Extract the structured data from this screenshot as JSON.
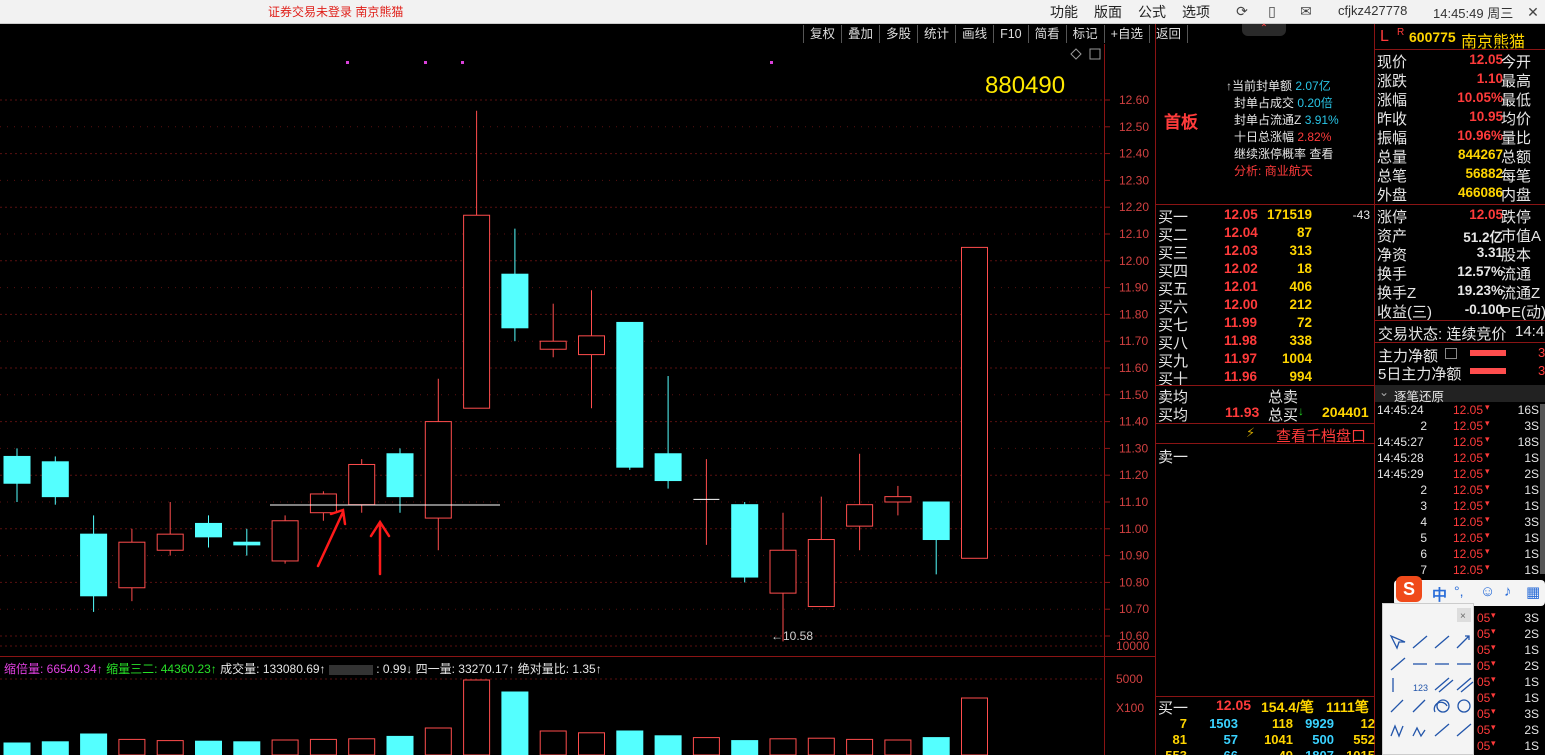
{
  "topbar": {
    "status": "证券交易未登录  南京熊猫",
    "menu": [
      "功能",
      "版面",
      "公式",
      "选项"
    ],
    "user": "cfjkz427778",
    "clock": "14:45:49 周三"
  },
  "chart_toolbar": [
    "复权",
    "叠加",
    "多股",
    "统计",
    "画线",
    "F10",
    "简看",
    "标记",
    "+自选",
    "返回"
  ],
  "chart": {
    "code_overlay": "880490",
    "low_label": "←10.58",
    "price_ticks": [
      "12.60",
      "12.50",
      "12.40",
      "12.30",
      "12.20",
      "12.10",
      "12.00",
      "11.90",
      "11.80",
      "11.70",
      "11.60",
      "11.50",
      "11.40",
      "11.30",
      "11.20",
      "11.10",
      "11.00",
      "10.90",
      "10.80",
      "10.70",
      "10.60"
    ],
    "volume_ticks": [
      "10000",
      "5000",
      "X100"
    ],
    "indicator_line": {
      "part1": "缩倍量: 66540.34↑",
      "part2": "缩量三二: 44360.23↑",
      "part3": "成交量: 133080.69↑",
      "part4": ": 0.99↓",
      "part5": "四一量: 33270.17↑",
      "part6": "绝对量比: 1.35↑"
    },
    "candles": [
      {
        "o": 11.27,
        "c": 11.17,
        "h": 11.3,
        "l": 11.1
      },
      {
        "o": 11.25,
        "c": 11.12,
        "h": 11.27,
        "l": 11.09
      },
      {
        "o": 10.98,
        "c": 10.75,
        "h": 11.05,
        "l": 10.69
      },
      {
        "o": 10.78,
        "c": 10.95,
        "h": 11.0,
        "l": 10.73
      },
      {
        "o": 10.92,
        "c": 10.98,
        "h": 11.1,
        "l": 10.9
      },
      {
        "o": 11.02,
        "c": 10.97,
        "h": 11.05,
        "l": 10.93
      },
      {
        "o": 10.95,
        "c": 10.94,
        "h": 11.0,
        "l": 10.9
      },
      {
        "o": 10.88,
        "c": 11.03,
        "h": 11.05,
        "l": 10.87
      },
      {
        "o": 11.06,
        "c": 11.13,
        "h": 11.14,
        "l": 11.03
      },
      {
        "o": 11.09,
        "c": 11.24,
        "h": 11.26,
        "l": 11.06
      },
      {
        "o": 11.28,
        "c": 11.12,
        "h": 11.3,
        "l": 11.06
      },
      {
        "o": 11.04,
        "c": 11.4,
        "h": 11.56,
        "l": 10.92
      },
      {
        "o": 11.45,
        "c": 12.17,
        "h": 12.56,
        "l": 11.45
      },
      {
        "o": 11.95,
        "c": 11.75,
        "h": 12.12,
        "l": 11.7
      },
      {
        "o": 11.67,
        "c": 11.7,
        "h": 11.84,
        "l": 11.64
      },
      {
        "o": 11.65,
        "c": 11.72,
        "h": 11.89,
        "l": 11.45
      },
      {
        "o": 11.77,
        "c": 11.23,
        "h": 11.77,
        "l": 11.22
      },
      {
        "o": 11.28,
        "c": 11.18,
        "h": 11.57,
        "l": 11.15
      },
      {
        "o": 11.11,
        "c": 11.11,
        "h": 11.26,
        "l": 10.94
      },
      {
        "o": 11.09,
        "c": 10.82,
        "h": 11.1,
        "l": 10.8
      },
      {
        "o": 10.76,
        "c": 10.92,
        "h": 11.06,
        "l": 10.58
      },
      {
        "o": 10.71,
        "c": 10.96,
        "h": 11.12,
        "l": 10.71
      },
      {
        "o": 11.01,
        "c": 11.09,
        "h": 11.28,
        "l": 10.92
      },
      {
        "o": 11.1,
        "c": 11.12,
        "h": 11.16,
        "l": 11.05
      },
      {
        "o": 11.1,
        "c": 10.96,
        "h": 11.1,
        "l": 10.83
      },
      {
        "o": 10.89,
        "c": 12.05,
        "h": 12.05,
        "l": 10.89
      }
    ],
    "volumes": [
      2000,
      2200,
      3500,
      2600,
      2400,
      2300,
      2200,
      2500,
      2600,
      2700,
      3100,
      4500,
      12500,
      10500,
      4000,
      3700,
      4000,
      3200,
      2900,
      2400,
      2700,
      2800,
      2600,
      2500,
      2900,
      9500
    ]
  },
  "info": {
    "first_board": "首板",
    "seal_amount_label": "当前封单额",
    "seal_amount": "2.07亿",
    "seal_vol_label": "封单占成交",
    "seal_vol": "0.20倍",
    "seal_float_label": "封单占流通Z",
    "seal_float": "3.91%",
    "ten_day_label": "十日总涨幅",
    "ten_day": "2.82%",
    "continue_label": "继续涨停概率",
    "continue_link": "查看",
    "analysis_label": "分析:",
    "analysis": "商业航天"
  },
  "orderbook": {
    "bids": [
      {
        "label": "买一",
        "price": "12.05",
        "vol": "171519",
        "chg": "-43"
      },
      {
        "label": "买二",
        "price": "12.04",
        "vol": "87",
        "chg": ""
      },
      {
        "label": "买三",
        "price": "12.03",
        "vol": "313",
        "chg": ""
      },
      {
        "label": "买四",
        "price": "12.02",
        "vol": "18",
        "chg": ""
      },
      {
        "label": "买五",
        "price": "12.01",
        "vol": "406",
        "chg": ""
      },
      {
        "label": "买六",
        "price": "12.00",
        "vol": "212",
        "chg": ""
      },
      {
        "label": "买七",
        "price": "11.99",
        "vol": "72",
        "chg": ""
      },
      {
        "label": "买八",
        "price": "11.98",
        "vol": "338",
        "chg": ""
      },
      {
        "label": "买九",
        "price": "11.97",
        "vol": "1004",
        "chg": ""
      },
      {
        "label": "买十",
        "price": "11.96",
        "vol": "994",
        "chg": ""
      }
    ],
    "sell_avg_label": "卖均",
    "sell_total_label": "总卖",
    "buy_avg_label": "买均",
    "buy_avg": "11.93",
    "buy_total_label": "总买",
    "buy_total": "204401",
    "view_qiandang": "查看千档盘口",
    "ask1_label": "卖一",
    "bottom": {
      "label": "买一",
      "price": "12.05",
      "per": "154.4/笔",
      "count": "1111笔",
      "row1": [
        "7",
        "1503",
        "118",
        "9929",
        "12"
      ],
      "row2": [
        "81",
        "57",
        "1041",
        "500",
        "552"
      ],
      "row3": [
        "553",
        "66",
        "49",
        "1807",
        "1015"
      ]
    }
  },
  "quote": {
    "flag": "L",
    "flag_r": "R",
    "code": "600775",
    "name": "南京熊猫",
    "rows1": [
      {
        "k": "现价",
        "v": "12.05",
        "k2": "今开"
      },
      {
        "k": "涨跌",
        "v": "1.10",
        "k2": "最高"
      },
      {
        "k": "涨幅",
        "v": "10.05%",
        "k2": "最低"
      },
      {
        "k": "昨收",
        "v": "10.95",
        "k2": "均价"
      },
      {
        "k": "振幅",
        "v": "10.96%",
        "k2": "量比"
      },
      {
        "k": "总量",
        "v": "844267",
        "k2": "总额"
      },
      {
        "k": "总笔",
        "v": "56882",
        "k2": "每笔"
      },
      {
        "k": "外盘",
        "v": "466086",
        "k2": "内盘"
      }
    ],
    "rows2": [
      {
        "k": "涨停",
        "v": "12.05",
        "k2": "跌停"
      },
      {
        "k": "资产",
        "v": "51.2亿",
        "k2": "市值A"
      },
      {
        "k": "净资",
        "v": "3.31",
        "k2": "股本"
      },
      {
        "k": "换手",
        "v": "12.57%",
        "k2": "流通"
      },
      {
        "k": "换手Z",
        "v": "19.23%",
        "k2": "流通Z"
      },
      {
        "k": "收益(三)",
        "v": "-0.100",
        "k2": "PE(动)"
      }
    ],
    "trade_status": "交易状态: 连续竞价",
    "trade_time": "14:4",
    "main_net": "主力净额",
    "main_net_val": "3",
    "main_net5": "5日主力净额",
    "main_net5_val": "3",
    "ticks_title": "逐笔还原",
    "ticks": [
      {
        "t": "14:45:24",
        "p": "12.05",
        "v": "16S"
      },
      {
        "t": "2",
        "p": "12.05",
        "v": "3S"
      },
      {
        "t": "14:45:27",
        "p": "12.05",
        "v": "18S"
      },
      {
        "t": "14:45:28",
        "p": "12.05",
        "v": "1S"
      },
      {
        "t": "14:45:29",
        "p": "12.05",
        "v": "2S"
      },
      {
        "t": "2",
        "p": "12.05",
        "v": "1S"
      },
      {
        "t": "3",
        "p": "12.05",
        "v": "1S"
      },
      {
        "t": "4",
        "p": "12.05",
        "v": "3S"
      },
      {
        "t": "5",
        "p": "12.05",
        "v": "1S"
      },
      {
        "t": "6",
        "p": "12.05",
        "v": "1S"
      },
      {
        "t": "7",
        "p": "12.05",
        "v": "1S"
      }
    ],
    "ticks_tail": [
      {
        "p": "05",
        "v": "3S"
      },
      {
        "p": "05",
        "v": "2S"
      },
      {
        "p": "05",
        "v": "1S"
      },
      {
        "p": "05",
        "v": "2S"
      },
      {
        "p": "05",
        "v": "1S"
      },
      {
        "p": "05",
        "v": "1S"
      },
      {
        "p": "05",
        "v": "3S"
      },
      {
        "p": "05",
        "v": "2S"
      },
      {
        "p": "05",
        "v": "1S"
      }
    ]
  },
  "ime": {
    "label": "中"
  }
}
